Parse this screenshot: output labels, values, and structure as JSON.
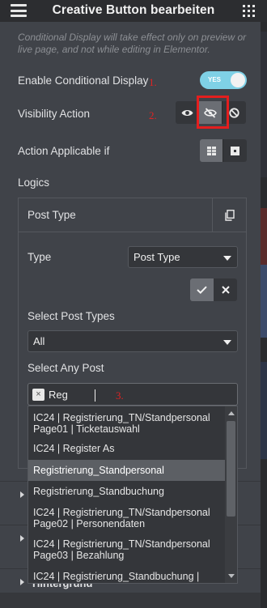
{
  "header": {
    "title": "Creative Button bearbeiten",
    "menu_icon": "hamburger-icon",
    "apps_icon": "grid-icon"
  },
  "notice": "Conditional Display will take effect only on preview or live page, and not while editing in Elementor.",
  "conditional_display": {
    "label": "Enable Conditional Display",
    "annotation": "1.",
    "toggle_text": "YES",
    "enabled": true
  },
  "visibility_action": {
    "label": "Visibility Action",
    "annotation": "2.",
    "options": [
      "show-icon",
      "hide-icon",
      "none-icon"
    ],
    "selected": "hide-icon"
  },
  "action_applicable": {
    "label": "Action Applicable if",
    "options": [
      "all-icon",
      "any-icon"
    ],
    "selected": "all-icon"
  },
  "logics": {
    "label": "Logics",
    "item": {
      "title": "Post Type",
      "type_label": "Type",
      "type_value": "Post Type",
      "select_post_types_label": "Select Post Types",
      "select_post_types_value": "All",
      "select_any_post_label": "Select Any Post",
      "search_text": "Reg",
      "annotation": "3.",
      "options": [
        "IC24 | Registrierung_TN/Standpersonal Page01 | Ticketauswahl",
        "IC24 | Register As",
        "Registrierung_Standpersonal",
        "Registrierung_Standbuchung",
        "IC24 | Registrierung_TN/Standpersonal Page02 | Personendaten",
        "IC24 | Registrierung_TN/Standpersonal Page03 | Bezahlung",
        "IC24 | Registrierung_Standbuchung |"
      ],
      "highlighted_option": "Registrierung_Standpersonal"
    }
  },
  "collapsed_sections": [
    {
      "label": ""
    },
    {
      "label": ""
    },
    {
      "label": "Hintergrund"
    }
  ],
  "colors": {
    "accent_toggle": "#7fd1e6",
    "annotation_red": "#e02323",
    "panel_bg": "#404349",
    "header_bg": "#2c2d30"
  }
}
